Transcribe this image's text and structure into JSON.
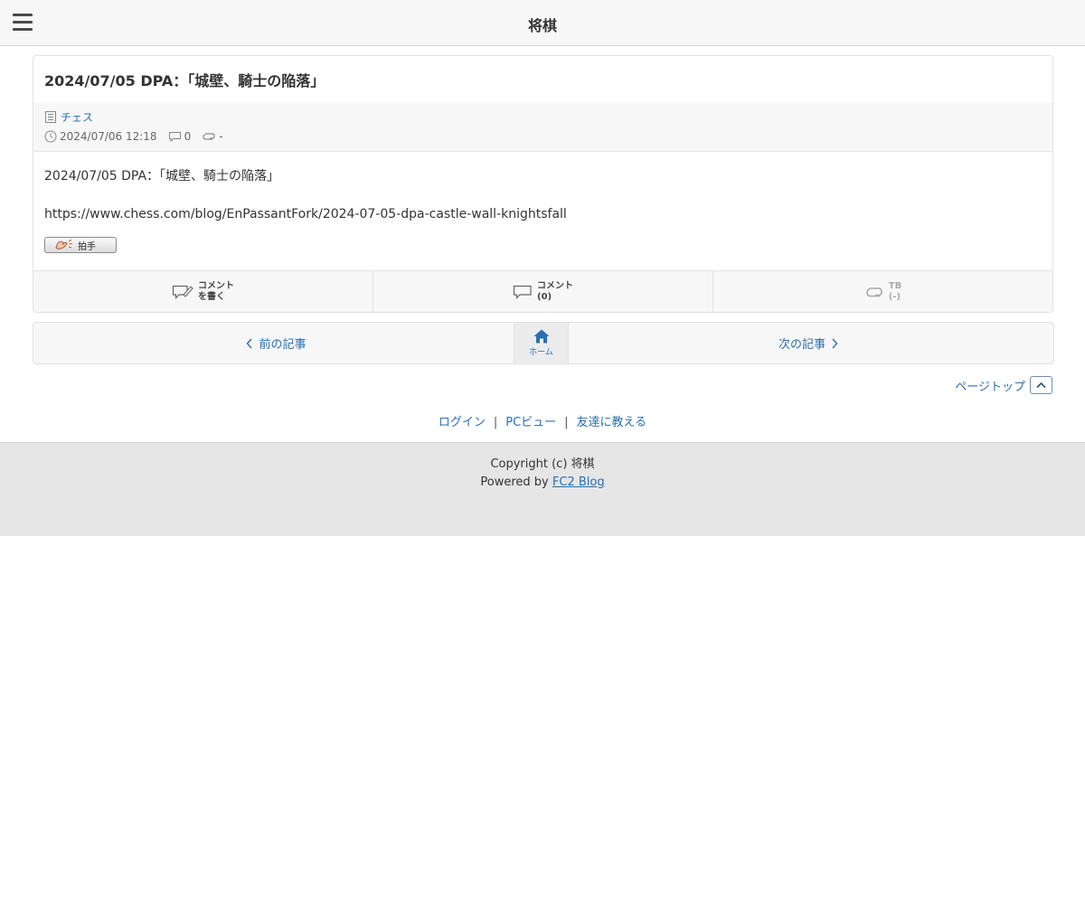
{
  "header": {
    "title": "将棋"
  },
  "article": {
    "title": "2024/07/05 DPA：「城壁、騎士の陥落」",
    "category": "チェス",
    "datetime": "2024/07/06 12:18",
    "comment_count": "0",
    "trackback_count": "-",
    "body_line": "2024/07/05 DPA：「城壁、騎士の陥落」",
    "body_url": "https://www.chess.com/blog/EnPassantFork/2024-07-05-dpa-castle-wall-knightsfall",
    "clap_label": "拍手",
    "actions": {
      "write_comment_line1": "コメント",
      "write_comment_line2": "を書く",
      "comments_line1": "コメント",
      "comments_line2": "(0)",
      "tb_line1": "TB",
      "tb_line2": "(-)"
    }
  },
  "pager": {
    "prev_label": "前の記事",
    "home_label": "ホーム",
    "next_label": "次の記事"
  },
  "pagetop": {
    "label": "ページトップ"
  },
  "footer_links": {
    "login": "ログイン",
    "pc_view": "PCビュー",
    "tell_friend": "友達に教える",
    "separator": "|"
  },
  "footer": {
    "copyright": "Copyright (c) 将棋",
    "powered_prefix": "Powered by",
    "powered_link": "FC2 Blog"
  },
  "colors": {
    "link": "#2a6fb0",
    "home_icon": "#2a6fb0",
    "footer_bg": "#e6e6e6"
  },
  "icons": {
    "menu": "hamburger-icon",
    "category": "document-icon",
    "time": "clock-icon",
    "comment": "speech-bubble-icon",
    "trackback": "loop-arrows-icon",
    "write": "pencil-bubble-icon",
    "home": "home-icon",
    "prev": "chevron-left-icon",
    "next": "chevron-right-icon",
    "pagetop": "chevron-up-icon"
  }
}
